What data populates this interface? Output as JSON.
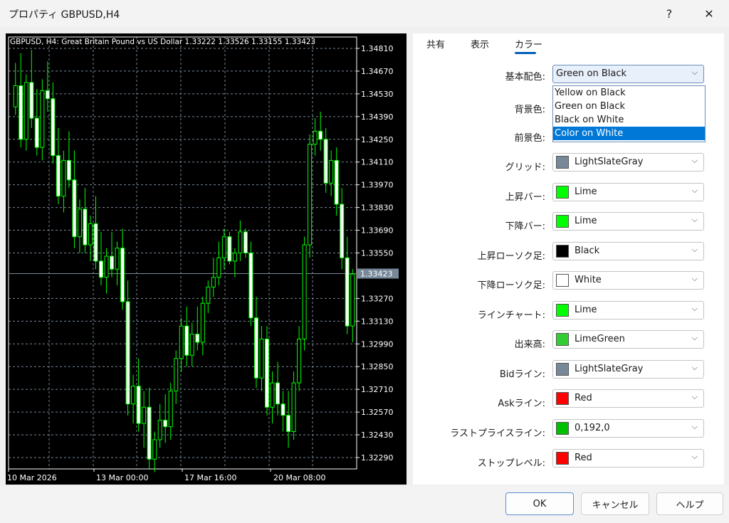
{
  "window": {
    "title": "プロパティ GBPUSD,H4",
    "help_glyph": "?",
    "close_glyph": "✕"
  },
  "tabs": [
    {
      "label": "共有"
    },
    {
      "label": "表示"
    },
    {
      "label": "カラー"
    }
  ],
  "active_tab": "カラー",
  "chart": {
    "header": "GBPUSD, H4:  Great Britain Pound vs US Dollar  1.33222 1.33526 1.33155 1.33423",
    "price_ticks": [
      "1.34810",
      "1.34670",
      "1.34530",
      "1.34390",
      "1.34250",
      "1.34110",
      "1.33970",
      "1.33830",
      "1.33690",
      "1.33550",
      "1.33270",
      "1.33130",
      "1.32990",
      "1.32850",
      "1.32710",
      "1.32570",
      "1.32430",
      "1.32290"
    ],
    "current_price": "1.33423",
    "current_price_value": 1.33423,
    "date_labels": [
      "10 Mar 2026",
      "13 Mar 00:00",
      "17 Mar 16:00",
      "20 Mar 08:00"
    ],
    "ylim": [
      1.3222,
      1.3488
    ],
    "colors": {
      "background": "#000000",
      "grid": "#778899",
      "up_body": "#000000",
      "down_body": "#ffffff",
      "wick": "#00ff00",
      "axis_text": "#ffffff",
      "price_line": "#778899"
    },
    "candles": [
      [
        1.3445,
        1.3472,
        1.344,
        1.3458
      ],
      [
        1.3458,
        1.3478,
        1.342,
        1.3425
      ],
      [
        1.3425,
        1.3465,
        1.3418,
        1.346
      ],
      [
        1.346,
        1.348,
        1.3432,
        1.3438
      ],
      [
        1.3438,
        1.3456,
        1.3415,
        1.342
      ],
      [
        1.342,
        1.3462,
        1.3412,
        1.3455
      ],
      [
        1.3455,
        1.3473,
        1.3442,
        1.345
      ],
      [
        1.345,
        1.346,
        1.341,
        1.3415
      ],
      [
        1.3415,
        1.3432,
        1.3385,
        1.339
      ],
      [
        1.339,
        1.3418,
        1.338,
        1.3412
      ],
      [
        1.3412,
        1.343,
        1.3395,
        1.34
      ],
      [
        1.34,
        1.3418,
        1.3358,
        1.3365
      ],
      [
        1.3365,
        1.3388,
        1.3355,
        1.3382
      ],
      [
        1.3382,
        1.3395,
        1.3355,
        1.336
      ],
      [
        1.336,
        1.3378,
        1.335,
        1.3373
      ],
      [
        1.3373,
        1.339,
        1.3345,
        1.335
      ],
      [
        1.335,
        1.3368,
        1.3335,
        1.334
      ],
      [
        1.334,
        1.3358,
        1.333,
        1.3353
      ],
      [
        1.3353,
        1.3368,
        1.334,
        1.3345
      ],
      [
        1.3345,
        1.3362,
        1.3335,
        1.3358
      ],
      [
        1.3358,
        1.337,
        1.332,
        1.3325
      ],
      [
        1.3325,
        1.3338,
        1.3255,
        1.3262
      ],
      [
        1.3262,
        1.328,
        1.325,
        1.3273
      ],
      [
        1.3273,
        1.329,
        1.3245,
        1.325
      ],
      [
        1.325,
        1.327,
        1.3235,
        1.326
      ],
      [
        1.326,
        1.3272,
        1.3222,
        1.3228
      ],
      [
        1.3228,
        1.3245,
        1.322,
        1.324
      ],
      [
        1.324,
        1.3262,
        1.3235,
        1.3252
      ],
      [
        1.3252,
        1.3268,
        1.3238,
        1.3248
      ],
      [
        1.3248,
        1.3275,
        1.324,
        1.327
      ],
      [
        1.327,
        1.3295,
        1.3262,
        1.329
      ],
      [
        1.329,
        1.3315,
        1.3282,
        1.331
      ],
      [
        1.331,
        1.3322,
        1.3285,
        1.3292
      ],
      [
        1.3292,
        1.3312,
        1.3285,
        1.3305
      ],
      [
        1.3305,
        1.3322,
        1.3295,
        1.33
      ],
      [
        1.33,
        1.3328,
        1.3292,
        1.3324
      ],
      [
        1.3324,
        1.3338,
        1.3318,
        1.3334
      ],
      [
        1.3334,
        1.3352,
        1.3328,
        1.334
      ],
      [
        1.334,
        1.3362,
        1.3335,
        1.3352
      ],
      [
        1.3352,
        1.337,
        1.3345,
        1.3365
      ],
      [
        1.3365,
        1.3368,
        1.3348,
        1.335
      ],
      [
        1.335,
        1.3358,
        1.334,
        1.3355
      ],
      [
        1.3355,
        1.3375,
        1.335,
        1.3368
      ],
      [
        1.3368,
        1.337,
        1.3352,
        1.3355
      ],
      [
        1.3355,
        1.3362,
        1.331,
        1.3315
      ],
      [
        1.3315,
        1.3328,
        1.3272,
        1.3278
      ],
      [
        1.3278,
        1.331,
        1.327,
        1.3302
      ],
      [
        1.3302,
        1.331,
        1.3255,
        1.326
      ],
      [
        1.326,
        1.3282,
        1.325,
        1.3275
      ],
      [
        1.3275,
        1.3288,
        1.3255,
        1.3262
      ],
      [
        1.3262,
        1.327,
        1.3245,
        1.3255
      ],
      [
        1.3255,
        1.327,
        1.3235,
        1.3245
      ],
      [
        1.3245,
        1.3282,
        1.324,
        1.3275
      ],
      [
        1.3275,
        1.331,
        1.327,
        1.3302
      ],
      [
        1.3302,
        1.3365,
        1.3295,
        1.336
      ],
      [
        1.336,
        1.3428,
        1.3352,
        1.3422
      ],
      [
        1.3422,
        1.3438,
        1.3415,
        1.343
      ],
      [
        1.343,
        1.3442,
        1.3418,
        1.3425
      ],
      [
        1.3425,
        1.3432,
        1.3392,
        1.3398
      ],
      [
        1.3398,
        1.3418,
        1.339,
        1.3412
      ],
      [
        1.3412,
        1.342,
        1.3378,
        1.3385
      ],
      [
        1.3385,
        1.3395,
        1.3345,
        1.3352
      ],
      [
        1.3352,
        1.3365,
        1.3305,
        1.331
      ],
      [
        1.331,
        1.3345,
        1.33,
        1.3342
      ]
    ]
  },
  "form": {
    "scheme_label": "基本配色:",
    "scheme_value": "Green on Black",
    "scheme_options": [
      "Yellow on Black",
      "Green on Black",
      "Black on White",
      "Color on White"
    ],
    "scheme_highlighted": "Color on White",
    "rows": [
      {
        "label": "背景色:"
      },
      {
        "label": "前景色:"
      },
      {
        "label": "グリッド:",
        "value": "LightSlateGray",
        "color": "#778899"
      },
      {
        "label": "上昇バー:",
        "value": "Lime",
        "color": "#00ff00"
      },
      {
        "label": "下降バー:",
        "value": "Lime",
        "color": "#00ff00"
      },
      {
        "label": "上昇ローソク足:",
        "value": "Black",
        "color": "#000000"
      },
      {
        "label": "下降ローソク足:",
        "value": "White",
        "color": "#ffffff"
      },
      {
        "label": "ラインチャート:",
        "value": "Lime",
        "color": "#00ff00"
      },
      {
        "label": "出来高:",
        "value": "LimeGreen",
        "color": "#32cd32"
      },
      {
        "label": "Bidライン:",
        "value": "LightSlateGray",
        "color": "#778899"
      },
      {
        "label": "Askライン:",
        "value": "Red",
        "color": "#ff0000"
      },
      {
        "label": "ラストプライスライン:",
        "value": "0,192,0",
        "color": "#00c000"
      },
      {
        "label": "ストップレベル:",
        "value": "Red",
        "color": "#ff0000"
      }
    ]
  },
  "buttons": {
    "ok": "OK",
    "cancel": "キャンセル",
    "help": "ヘルプ"
  },
  "chevron": "⌵"
}
